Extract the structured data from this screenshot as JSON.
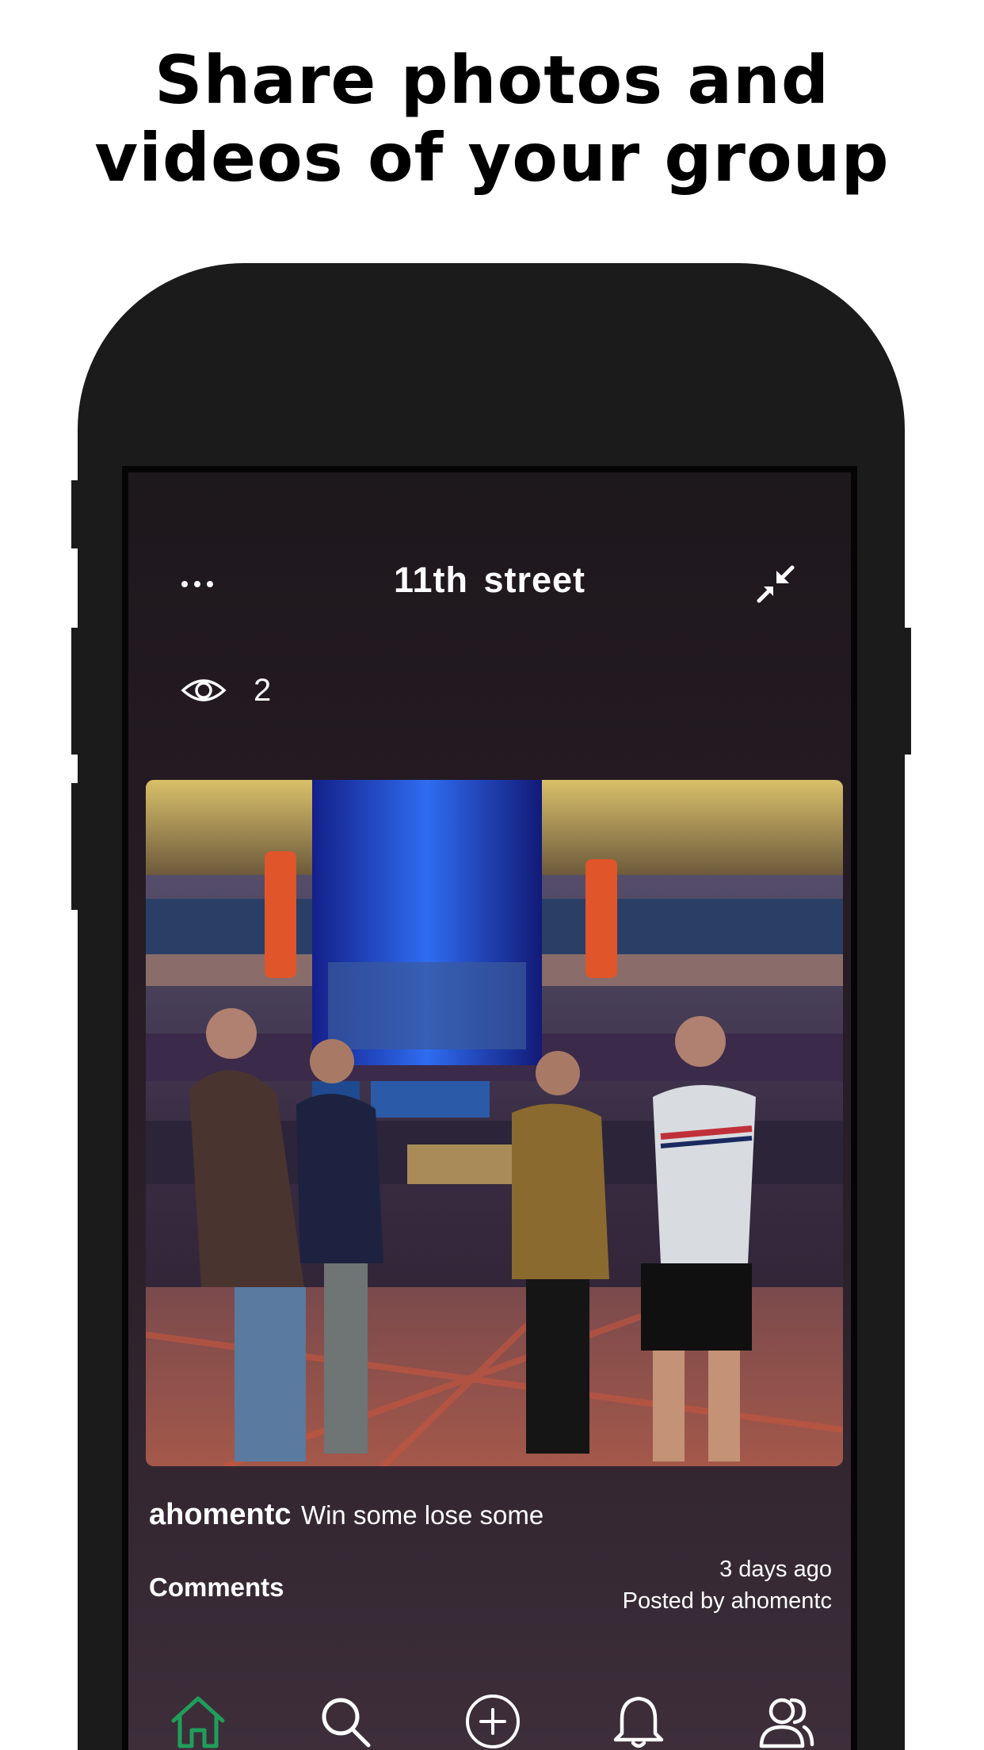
{
  "headline": {
    "line1": "Share photos and",
    "line2": "videos of your group"
  },
  "header": {
    "title": "11th  street",
    "more_icon": "more-horizontal-icon",
    "collapse_icon": "collapse-arrows-icon"
  },
  "views": {
    "icon": "eye-icon",
    "count": "2"
  },
  "post": {
    "image": "group-photo",
    "username": "ahomentc",
    "caption": "Win some lose some",
    "comments_label": "Comments",
    "time_ago": "3 days ago",
    "posted_by": "Posted by ahomentc"
  },
  "tabbar": {
    "items": [
      {
        "name": "home",
        "icon": "home-icon",
        "active": true
      },
      {
        "name": "search",
        "icon": "search-icon",
        "active": false
      },
      {
        "name": "add",
        "icon": "plus-circle-icon",
        "active": false
      },
      {
        "name": "notifications",
        "icon": "bell-icon",
        "active": false
      },
      {
        "name": "groups",
        "icon": "people-icon",
        "active": false
      }
    ]
  },
  "colors": {
    "accent": "#1f9e5a",
    "screen_bg": "#261c24",
    "frame": "#1b1b1b"
  }
}
